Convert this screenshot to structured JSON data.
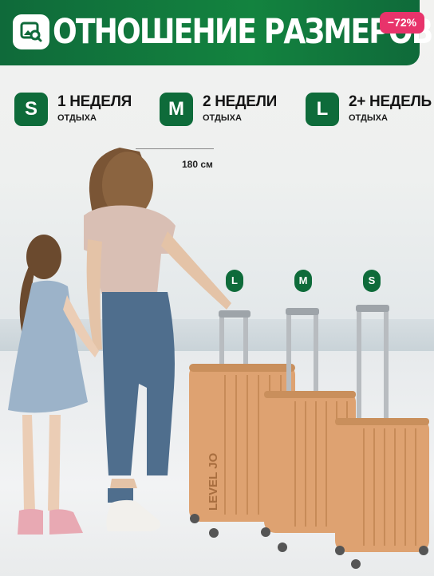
{
  "banner": {
    "title": "ОТНОШЕНИЕ РАЗМЕРОВ",
    "discount": "−72%"
  },
  "sizes": [
    {
      "letter": "S",
      "title": "1 НЕДЕЛЯ",
      "sub": "ОТДЫХА"
    },
    {
      "letter": "M",
      "title": "2 НЕДЕЛИ",
      "sub": "ОТДЫХА"
    },
    {
      "letter": "L",
      "title": "2+ НЕДЕЛЬ",
      "sub": "ОТДЫХА"
    }
  ],
  "person_height": "180 см",
  "suitcase_tags": [
    "L",
    "M",
    "S"
  ],
  "brand_text": "LEVEL JO",
  "colors": {
    "banner_green": "#13833f",
    "badge_green": "#0e6b3a",
    "suitcase_orange": "#dea271",
    "discount_pink": "#e8336b"
  }
}
